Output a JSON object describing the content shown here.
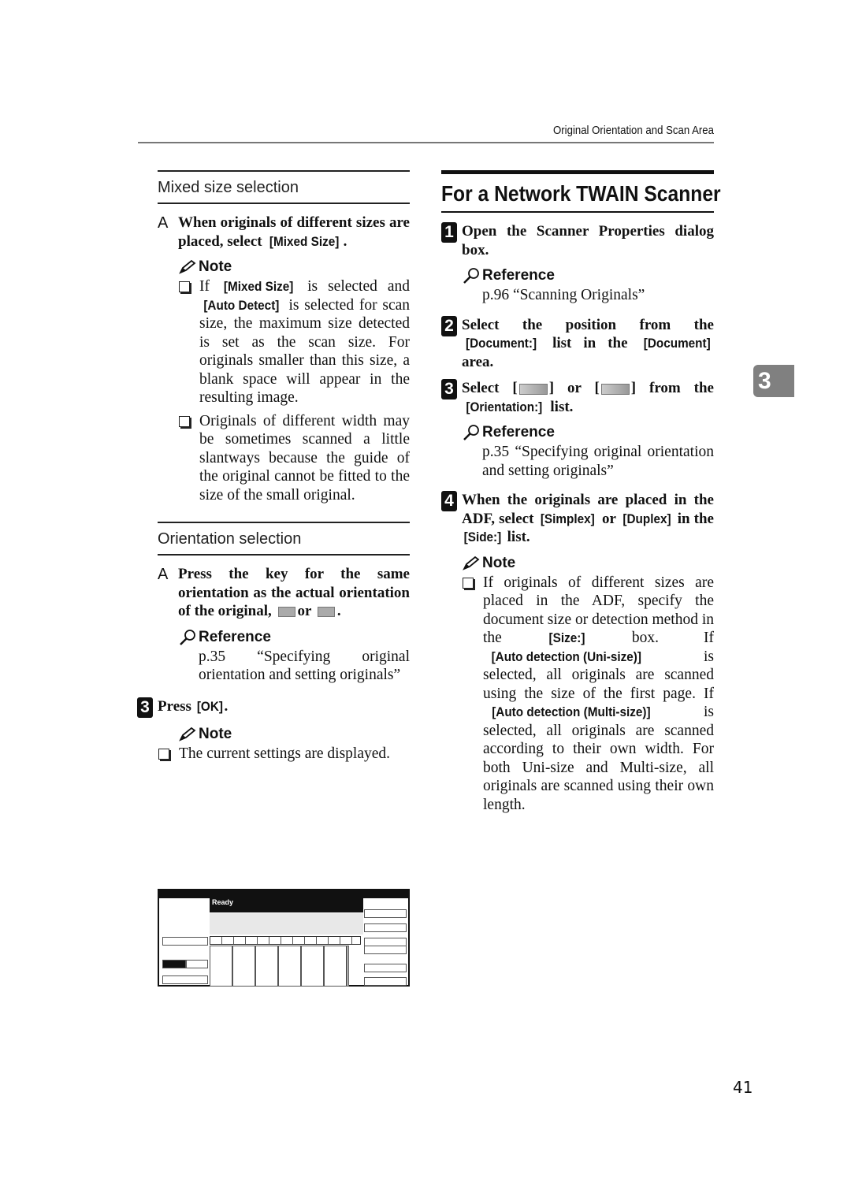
{
  "header": {
    "running_title": "Original Orientation and Scan Area"
  },
  "chapter_tab": "3",
  "page_number": "41",
  "left": {
    "mixed": {
      "heading": "Mixed size selection",
      "step_marker": "A",
      "step_parts": [
        "When originals of different sizes are placed, select ",
        "[Mixed Size]",
        "."
      ],
      "note_label": "Note",
      "bullets": [
        {
          "parts": [
            "If ",
            "[Mixed Size]",
            " is selected and ",
            "[Auto Detect]",
            " is selected for scan size, the maximum size detected is set as the scan size. For originals smaller than this size, a blank space will appear in the resulting image."
          ]
        },
        {
          "parts": [
            "Originals of different width may be sometimes scanned a little slantways because the guide of the original cannot be fitted to the size of the small original."
          ]
        }
      ]
    },
    "orientation": {
      "heading": "Orientation selection",
      "step_marker": "A",
      "step_text_a": "Press the key for the same orientation as the actual orientation of the original,",
      "step_or": "or",
      "step_end": ".",
      "icons": [
        "orientation-portrait-key-icon",
        "orientation-landscape-key-icon"
      ],
      "reference_label": "Reference",
      "reference_text": "p.35 “Specifying original orientation and setting originals”"
    },
    "step3": {
      "number": "3",
      "text_a": "Press ",
      "key": "[OK]",
      "text_b": ".",
      "note_label": "Note",
      "note_bullet": "The current settings are displayed."
    },
    "screenshot": {
      "status": "Ready",
      "description": "Scanner display panel thumbnail showing current settings"
    }
  },
  "right": {
    "title": "For a Network TWAIN Scanner",
    "steps": [
      {
        "number": "1",
        "text": "Open the Scanner Properties dialog box.",
        "reference_label": "Reference",
        "reference_text": "p.96 “Scanning Originals”"
      },
      {
        "number": "2",
        "parts": [
          "Select the position from the ",
          "[Document:]",
          " list in the ",
          "[Document]",
          " area."
        ]
      },
      {
        "number": "3",
        "text_a": "Select [",
        "text_b": "] or [",
        "text_c": "] from the ",
        "key": "[Orientation:]",
        "text_d": " list.",
        "reference_label": "Reference",
        "reference_text": "p.35 “Specifying original orientation and setting originals”"
      },
      {
        "number": "4",
        "parts": [
          "When the originals are placed in the ADF, select ",
          "[Simplex]",
          " or ",
          "[Duplex]",
          " in the ",
          "[Side:]",
          " list."
        ],
        "note_label": "Note",
        "note_parts": [
          "If originals of different sizes are placed in the ADF, specify the document size or detection method in the ",
          "[Size:]",
          " box. If ",
          "[Auto detection (Uni-size)]",
          " is selected, all originals are scanned using the size of the first page. If ",
          "[Auto detection (Multi-size)]",
          " is selected, all originals are scanned according to their own width. For both Uni-size and Multi-size, all originals are scanned using their own length."
        ]
      }
    ]
  }
}
